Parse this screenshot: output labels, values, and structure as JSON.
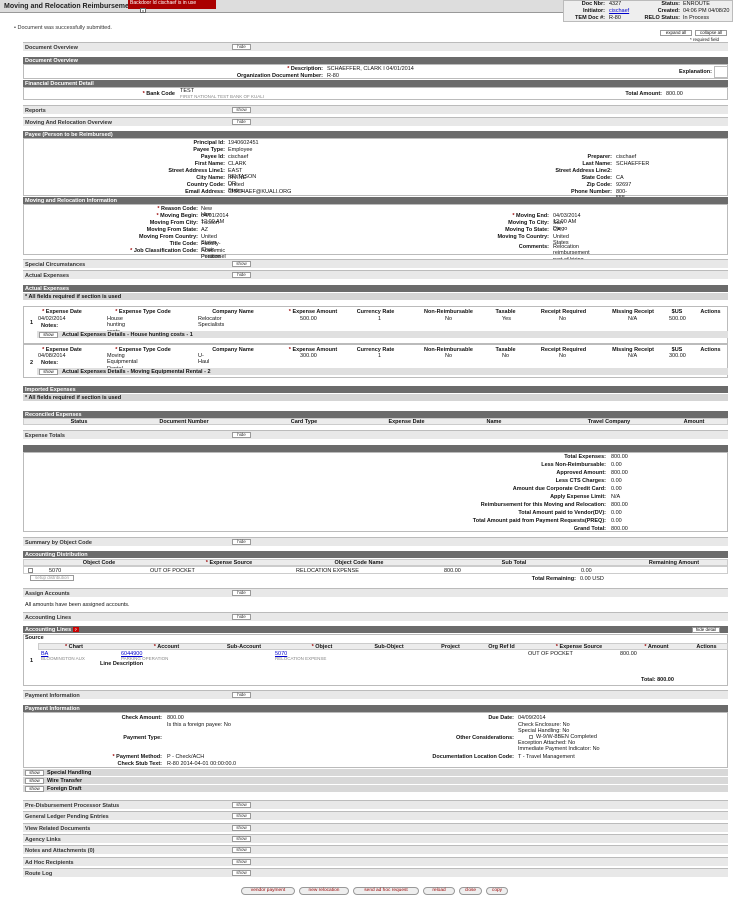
{
  "header": {
    "title": "Moving and Relocation Reimburseme",
    "backdoor": "Backdoor Id cischaef is in use",
    "doc_nbr_label": "Doc Nbr:",
    "doc_nbr": "4327",
    "status_label": "Status:",
    "status": "ENROUTE",
    "initiator_label": "Initiator:",
    "initiator": "cischaef",
    "created_label": "Created:",
    "created": "04:06 PM 04/08/20",
    "tem_label": "TEM Doc #:",
    "tem": "R-80",
    "relo_label": "RELO Status:",
    "relo": "In Process"
  },
  "message": "Document was successfully submitted.",
  "expand_all": "expand all",
  "collapse_all": "collapse all",
  "required_note": "* required field",
  "hide": "hide",
  "show": "show",
  "tabs": {
    "document_overview": "Document Overview",
    "reports": "Reports",
    "moving_overview": "Moving And Relocation Overview",
    "special": "Special Circumstances",
    "actual_expenses": "Actual Expenses",
    "expense_totals": "Expense Totals",
    "summary": "Summary by Object Code",
    "assign": "Assign Accounts",
    "acct_lines": "Accounting Lines",
    "payment": "Payment Information",
    "pre_disb": "Pre-Disbursement Processor Status",
    "gl": "General Ledger Pending Entries",
    "related": "View Related Documents",
    "agency": "Agency Links",
    "notes": "Notes and Attachments (0)",
    "adhoc": "Ad Hoc Recipients",
    "route": "Route Log"
  },
  "doc_overview": {
    "section": "Document Overview",
    "desc_label": "Description:",
    "desc": "SCHAEFFER, CLARK I 04/01/2014",
    "explanation_label": "Explanation:",
    "org_label": "Organization Document Number:",
    "org": "R-80",
    "fin_section": "Financial Document Detail",
    "bank_label": "Bank Code",
    "bank": "TEST",
    "bank_sub": "FIRST NATIONAL TEST BANK OF KUALI",
    "total_label": "Total Amount:",
    "total": "800.00"
  },
  "payee": {
    "section": "Payee (Person to be Reimbursed)",
    "rows_left": [
      [
        "Principal Id:",
        "1940602451"
      ],
      [
        "Payee Type:",
        "Employee"
      ],
      [
        "Payee Id:",
        "cischaef"
      ],
      [
        "First Name:",
        "CLARK"
      ],
      [
        "Street Address Line1:",
        "EAST FELTASON DR"
      ],
      [
        "City Name:",
        "IRVINE"
      ],
      [
        "Country Code:",
        "United States"
      ],
      [
        "Email Address:",
        "CISCHAEF@KUALI.ORG"
      ]
    ],
    "rows_right": [
      [
        "Preparer:",
        "cischaef"
      ],
      [
        "Last Name:",
        "SCHAEFFER"
      ],
      [
        "Street Address Line2:",
        ""
      ],
      [
        "State Code:",
        "CA"
      ],
      [
        "Zip Code:",
        "92697"
      ],
      [
        "Phone Number:",
        "800-555-1212"
      ]
    ]
  },
  "moving": {
    "section": "Moving and Relocation Information",
    "rows_left": [
      [
        "Reason Code:",
        "New Hire"
      ],
      [
        "Moving Begin:",
        "04/01/2014 12:00 AM"
      ],
      [
        "Moving From City:",
        "Tucson"
      ],
      [
        "Moving From State:",
        "AZ"
      ],
      [
        "Moving From Country:",
        "United States"
      ],
      [
        "Title Code:",
        "Faculty-Chair - Position 23487234"
      ],
      [
        "Job Classification Code:",
        "Academic Personnel"
      ]
    ],
    "rows_right": [
      [
        "Moving End:",
        "04/03/2014 12:00 AM"
      ],
      [
        "Moving To City:",
        "San Diego"
      ],
      [
        "Moving To State:",
        "CA"
      ],
      [
        "Moving To Country:",
        "United States"
      ],
      [
        "Comments:",
        "Relocation reimbursement part of hiring package."
      ]
    ]
  },
  "expenses": {
    "section": "Actual Expenses",
    "required": "* All fields required if section is used",
    "cols": [
      "Expense Date",
      "Expense Type Code",
      "Company Name",
      "Expense Amount",
      "Currency Rate",
      "Non-Reimbursable",
      "Taxable",
      "Receipt Required",
      "Missing Receipt",
      "$US",
      "Actions"
    ],
    "notes_label": "Notes:",
    "rows": [
      {
        "num": "1",
        "date": "04/02/2014",
        "type": "House hunting costs",
        "company": "Relocator Specialists",
        "amount": "500.00",
        "rate": "1",
        "nonreimb": "No",
        "taxable": "Yes",
        "receipt": "No",
        "missing": "N/A",
        "usd": "500.00",
        "detail": "Actual Expenses Details - House hunting costs - 1"
      },
      {
        "num": "2",
        "date": "04/08/2014",
        "type": "Moving Equipmental Rental",
        "company": "U-Haul",
        "amount": "300.00",
        "rate": "1",
        "nonreimb": "No",
        "taxable": "No",
        "receipt": "No",
        "missing": "N/A",
        "usd": "300.00",
        "detail": "Actual Expenses Details - Moving Equipmental Rental - 2"
      }
    ],
    "imported": "Imported Expenses",
    "imported_req": "* All fields required if section is used",
    "reconciled": "Reconciled Expenses",
    "recon_cols": [
      "Status",
      "Document Number",
      "Card Type",
      "Expense Date",
      "Name",
      "Travel Company",
      "Amount"
    ]
  },
  "totals": {
    "rows": [
      [
        "Total Expenses:",
        "800.00"
      ],
      [
        "Less Non-Reimbursable:",
        "0.00"
      ],
      [
        "Approved Amount:",
        "800.00"
      ],
      [
        "Less CTS Charges:",
        "0.00"
      ],
      [
        "Amount due Corporate Credit Card:",
        "0.00"
      ],
      [
        "Apply Expense Limit:",
        "N/A"
      ],
      [
        "Reimbursement for this Moving and Relocation:",
        "800.00"
      ],
      [
        "Total Amount paid to Vendor(DV):",
        "0.00"
      ],
      [
        "Total Amount paid from Payment Requests(PREQ):",
        "0.00"
      ],
      [
        "Grand Total:",
        "800.00"
      ]
    ]
  },
  "distribution": {
    "section": "Accounting Distribution",
    "cols": [
      "Object Code",
      "Expense Source",
      "Object Code Name",
      "Sub Total",
      "Remaining Amount"
    ],
    "object": "5070",
    "source": "OUT OF POCKET",
    "name": "RELOCATION EXPENSE",
    "subtotal": "800.00",
    "remaining": "0.00",
    "setup": "setup distribution",
    "remaining_label": "Total Remaining:",
    "remaining_total": "0.00 USD"
  },
  "assign_text": "All amounts have been assigned accounts.",
  "lines": {
    "section": "Accounting Lines",
    "hide_detail": "hide detail",
    "source": "Source",
    "cols": [
      "Chart",
      "Account",
      "Sub-Account",
      "Object",
      "Sub-Object",
      "Project",
      "Org Ref Id",
      "Expense Source",
      "Amount",
      "Actions"
    ],
    "num": "1",
    "chart": "BA",
    "chart_sub": "BLOOMINGTON AUX",
    "account": "6044900",
    "account_sub": "PARKING OPERATION",
    "object": "5070",
    "object_sub": "RELOCATION EXPENSE",
    "exp_source": "OUT OF POCKET",
    "amount": "800.00",
    "line_desc": "Line Description",
    "total": "Total: 800.00"
  },
  "payment": {
    "section": "Payment Information",
    "check_label": "Check Amount:",
    "check": "800.00",
    "due_label": "Due Date:",
    "due": "04/09/2014",
    "type_label": "Payment Type:",
    "type": "Is this a foreign payee: No",
    "other_label": "Other Considerations:",
    "other": [
      "Check Enclosure: No",
      "Special Handling: No",
      "W-9/W-8BEN Completed",
      "Exception Attached: No",
      "Immediate Payment Indicator: No"
    ],
    "method_label": "Payment Method:",
    "method": "P - Check/ACH",
    "doc_loc_label": "Documentation Location Code:",
    "doc_loc": "T - Travel Management",
    "stub_label": "Check Stub Text:",
    "stub": "R-80 2014-04-01 00:00:00.0",
    "special": "Special Handling",
    "wire": "Wire Transfer",
    "foreign": "Foreign Draft"
  },
  "buttons": [
    "vendor payment",
    "new relocation",
    "send ad hoc request",
    "reload",
    "close",
    "copy"
  ]
}
